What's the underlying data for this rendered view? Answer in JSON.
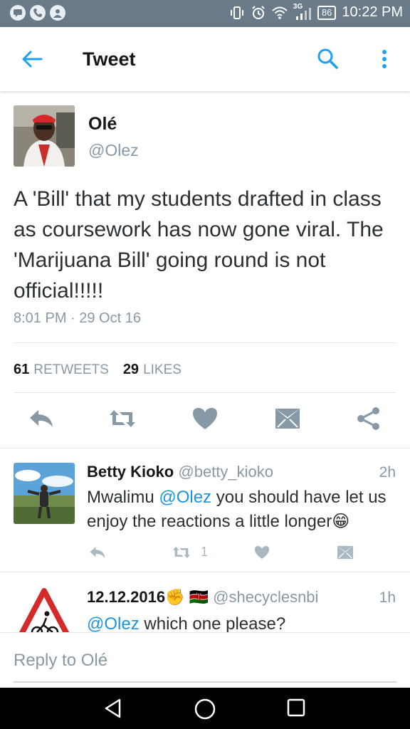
{
  "status_bar": {
    "network": "3G",
    "battery": "86",
    "time": "10:22 PM"
  },
  "app_bar": {
    "title": "Tweet",
    "back_icon": "arrow-left-icon",
    "search_icon": "search-icon",
    "more_icon": "more-vertical-icon"
  },
  "tweet": {
    "name": "Olé",
    "handle": "@Olez",
    "text": "A 'Bill' that my students drafted in class as coursework has now gone viral. The 'Marijuana Bill' going round is not official!!!!!",
    "timestamp": "8:01 PM · 29 Oct 16",
    "retweets_count": "61",
    "retweets_label": "RETWEETS",
    "likes_count": "29",
    "likes_label": "LIKES"
  },
  "replies": [
    {
      "name": "Betty Kioko",
      "handle": "@betty_kioko",
      "time": "2h",
      "mention": "@Olez",
      "text_before": "Mwalimu ",
      "text_after": " you should have let us enjoy the reactions a little longer😁",
      "retweet_count": "1"
    },
    {
      "name": "12.12.2016",
      "name_emoji": "✊ 🇰🇪",
      "handle": "@shecyclesnbi",
      "time": "1h",
      "mention": "@Olez",
      "text_after": " which one please?"
    }
  ],
  "composer": {
    "placeholder": "Reply to Olé"
  },
  "colors": {
    "accent": "#1b95e0",
    "status_bar": "#6b7a89",
    "icon_gray": "#8899a6"
  }
}
